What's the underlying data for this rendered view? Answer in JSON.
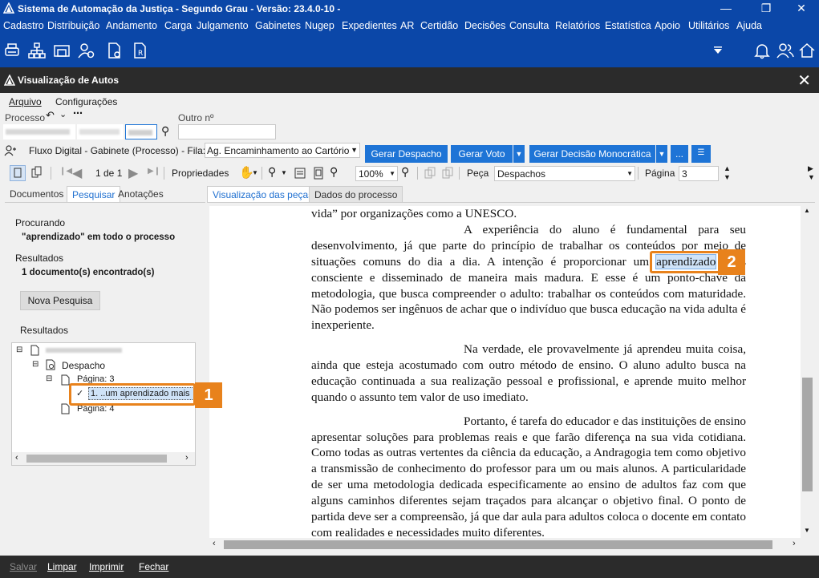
{
  "app": {
    "title": "Sistema de Automação da Justiça - Segundo Grau - Versão: 23.4.0-10 -",
    "menu": [
      "Cadastro",
      "Distribuição",
      "Andamento",
      "Carga",
      "Julgamento",
      "Gabinetes",
      "Nugep",
      "Expedientes",
      "AR",
      "Certidão",
      "Decisões",
      "Consulta",
      "Relatórios",
      "Estatística",
      "Apoio",
      "Utilitários",
      "Ajuda"
    ]
  },
  "window": {
    "title": "Visualização de Autos"
  },
  "submenu": {
    "arquivo": "Arquivo",
    "config": "Configurações"
  },
  "processo": {
    "label": "Processo",
    "outro_label": "Outro nº"
  },
  "flow": {
    "label": "Fluxo Digital - Gabinete (Processo) - Fila:",
    "queue_value": "Ag. Encaminhamento ao Cartório",
    "btn_despacho": "Gerar Despacho",
    "btn_voto": "Gerar Voto",
    "btn_monocratica": "Gerar Decisão Monocrática",
    "btn_more": "..."
  },
  "toolbar": {
    "page_counter": "1 de 1",
    "propriedades": "Propriedades",
    "zoom": "100%",
    "peca_label": "Peça",
    "peca_value": "Despachos",
    "pagina_label": "Página",
    "pagina_value": "3"
  },
  "left_tabs": [
    "Documentos",
    "Pesquisar",
    "Anotações"
  ],
  "search": {
    "procurando_label": "Procurando",
    "procurando_value": "\"aprendizado\" em todo o processo",
    "resultados_label": "Resultados",
    "resultados_value": "1 documento(s) encontrado(s)",
    "nova_pesquisa": "Nova Pesquisa",
    "resultados_tree_label": "Resultados",
    "tree_despacho": "Despacho",
    "tree_pagina3": "Página: 3",
    "tree_hit": "1. ..um aprendizado mais",
    "tree_pagina4": "Página: 4"
  },
  "doc_tabs": [
    "Visualização das peças",
    "Dados do processo"
  ],
  "document": {
    "p0": "vida” por organizações como a UNESCO.",
    "p1a": "A experiência do aluno é fundamental para seu desenvolvimento, já que parte do princípio de trabalhar os conteúdos por meio de situações comuns do dia a dia. A intenção é proporcionar um ",
    "p1hl": "aprendizado",
    "p1b": " mais consciente e disseminado de maneira mais madura.  E esse é um ponto-chave da metodologia, que busca compreender o adulto: trabalhar os conteúdos com maturidade. Não podemos ser ingênuos de achar que o indivíduo que busca educação na vida adulta é inexperiente.",
    "p2": "Na verdade, ele provavelmente já aprendeu muita coisa, ainda que esteja acostumado com outro método de ensino. O aluno adulto busca na educação continuada a sua realização pessoal e profissional, e aprende muito melhor quando o assunto tem valor de uso imediato.",
    "p3": "Portanto, é tarefa do educador e das instituições de ensino apresentar soluções para problemas reais e que farão diferença na sua vida cotidiana. Como todas as outras vertentes da ciência da educação, a Andragogia tem como objetivo a transmissão de conhecimento do professor para um ou mais alunos. A particularidade de ser uma metodologia dedicada especificamente ao ensino de adultos faz com que alguns caminhos diferentes sejam traçados para alcançar o objetivo final. O ponto de partida deve ser a compreensão, já que dar aula para adultos coloca o docente em contato com realidades e necessidades muito diferentes."
  },
  "callouts": [
    "1",
    "2"
  ],
  "bottom": [
    "Salvar",
    "Limpar",
    "Imprimir",
    "Fechar"
  ],
  "colors": {
    "accent": "#0b47a8",
    "button": "#1e74d6",
    "callout": "#e8821c",
    "dark": "#2b2b2b"
  }
}
